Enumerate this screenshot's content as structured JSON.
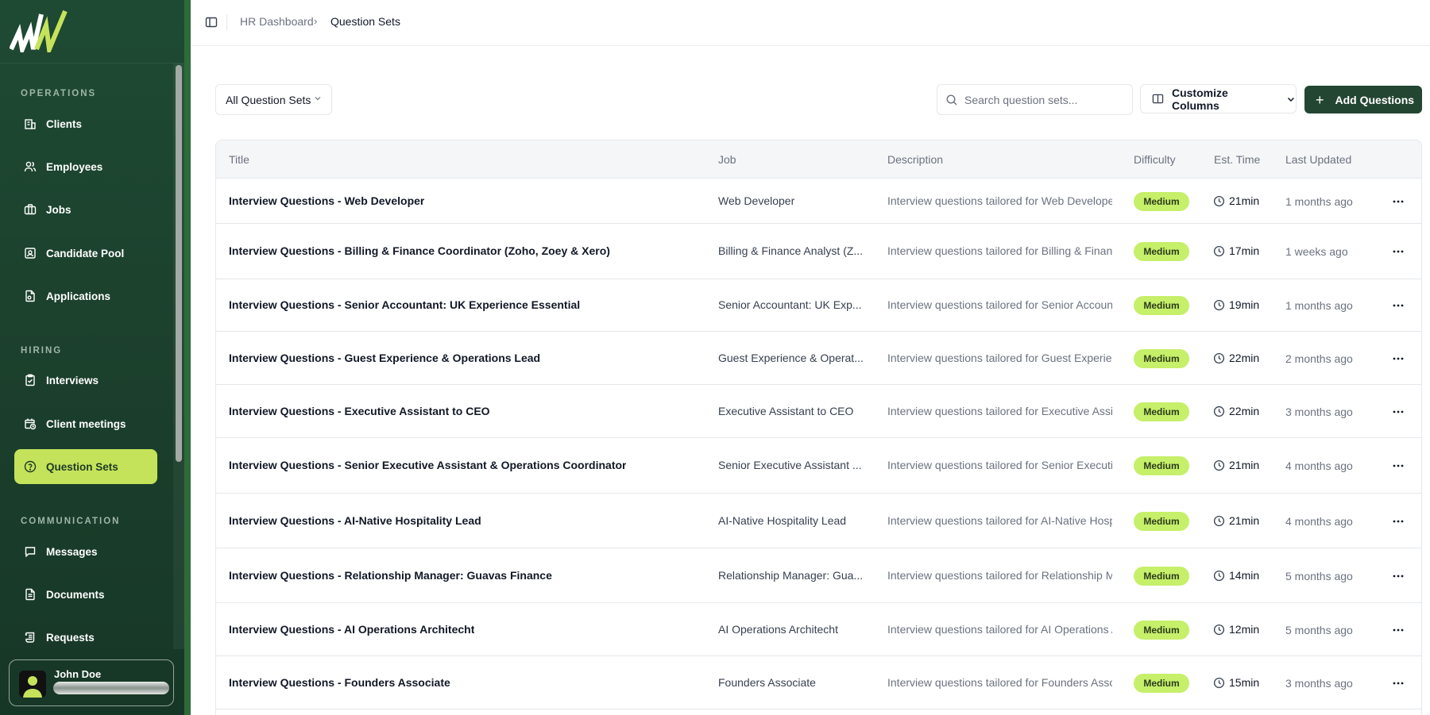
{
  "sidebar": {
    "sections": [
      {
        "title": "OPERATIONS",
        "items": [
          {
            "label": "Clients",
            "icon": "building-icon"
          },
          {
            "label": "Employees",
            "icon": "users-icon"
          },
          {
            "label": "Jobs",
            "icon": "briefcase-icon"
          },
          {
            "label": "Candidate Pool",
            "icon": "contact-icon"
          },
          {
            "label": "Applications",
            "icon": "file-icon"
          }
        ]
      },
      {
        "title": "HIRING",
        "items": [
          {
            "label": "Interviews",
            "icon": "clipboard-check-icon"
          },
          {
            "label": "Client meetings",
            "icon": "calendar-clock-icon"
          },
          {
            "label": "Question Sets",
            "icon": "help-circle-icon",
            "active": true
          }
        ]
      },
      {
        "title": "COMMUNICATION",
        "items": [
          {
            "label": "Messages",
            "icon": "message-icon"
          },
          {
            "label": "Documents",
            "icon": "document-icon"
          },
          {
            "label": "Requests",
            "icon": "scroll-icon"
          }
        ]
      }
    ],
    "user": {
      "name": "John Doe"
    }
  },
  "breadcrumb": {
    "parent": "HR Dashboard",
    "current": "Question Sets"
  },
  "toolbar": {
    "filter_label": "All Question Sets",
    "search_placeholder": "Search question sets...",
    "customize_label": "Customize Columns",
    "add_label": "Add Questions"
  },
  "table": {
    "columns": [
      "Title",
      "Job",
      "Description",
      "Difficulty",
      "Est. Time",
      "Last Updated"
    ],
    "rows": [
      {
        "title": "Interview Questions - Web Developer",
        "job": "Web Developer",
        "description": "Interview questions tailored for Web Developer",
        "difficulty": "Medium",
        "time": "21min",
        "updated": "1 months ago"
      },
      {
        "title": "Interview Questions - Billing & Finance Coordinator (Zoho, Zoey & Xero)",
        "job": "Billing & Finance Analyst (Z...",
        "description": "Interview questions tailored for Billing & Financ",
        "difficulty": "Medium",
        "time": "17min",
        "updated": "1 weeks ago"
      },
      {
        "title": "Interview Questions - Senior Accountant: UK Experience Essential",
        "job": "Senior Accountant: UK Exp...",
        "description": "Interview questions tailored for Senior Accounta",
        "difficulty": "Medium",
        "time": "19min",
        "updated": "1 months ago"
      },
      {
        "title": "Interview Questions - Guest Experience & Operations Lead",
        "job": "Guest Experience & Operat...",
        "description": "Interview questions tailored for Guest Experienc",
        "difficulty": "Medium",
        "time": "22min",
        "updated": "2 months ago"
      },
      {
        "title": "Interview Questions - Executive Assistant to CEO",
        "job": "Executive Assistant to CEO",
        "description": "Interview questions tailored for Executive Assis",
        "difficulty": "Medium",
        "time": "22min",
        "updated": "3 months ago"
      },
      {
        "title": "Interview Questions - Senior Executive Assistant & Operations Coordinator",
        "job": "Senior Executive Assistant ...",
        "description": "Interview questions tailored for Senior Executiv",
        "difficulty": "Medium",
        "time": "21min",
        "updated": "4 months ago"
      },
      {
        "title": "Interview Questions - AI-Native Hospitality Lead",
        "job": "AI-Native Hospitality Lead",
        "description": "Interview questions tailored for AI-Native Hospi",
        "difficulty": "Medium",
        "time": "21min",
        "updated": "4 months ago"
      },
      {
        "title": "Interview Questions - Relationship Manager: Guavas Finance",
        "job": "Relationship Manager: Gua...",
        "description": "Interview questions tailored for Relationship Ma",
        "difficulty": "Medium",
        "time": "14min",
        "updated": "5 months ago"
      },
      {
        "title": "Interview Questions - AI Operations Architecht",
        "job": "AI Operations Architecht",
        "description": "Interview questions tailored for AI Operations A",
        "difficulty": "Medium",
        "time": "12min",
        "updated": "5 months ago"
      },
      {
        "title": "Interview Questions - Founders Associate",
        "job": "Founders Associate",
        "description": "Interview questions tailored for Founders Assoc",
        "difficulty": "Medium",
        "time": "15min",
        "updated": "3 months ago"
      }
    ]
  },
  "colors": {
    "sidebar_bg": "#1e4a33",
    "accent": "#c5e35a",
    "badge": "#c6ef6a",
    "primary_button": "#234632"
  }
}
